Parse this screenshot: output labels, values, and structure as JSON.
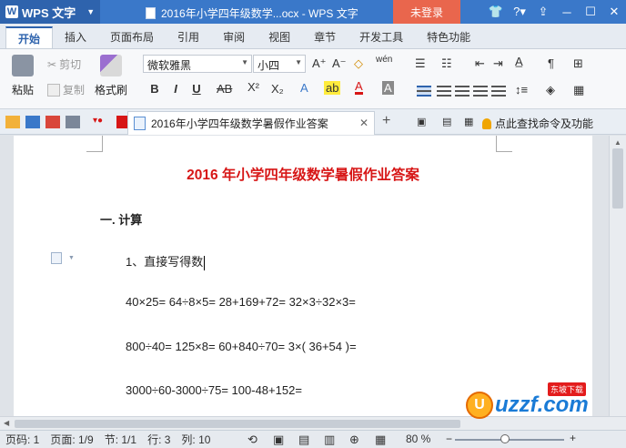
{
  "app": {
    "name": "WPS 文字",
    "window_title": "2016年小学四年级数学...ocx - WPS 文字",
    "login_label": "未登录"
  },
  "tabs": [
    {
      "label": "开始",
      "active": true
    },
    {
      "label": "插入"
    },
    {
      "label": "页面布局"
    },
    {
      "label": "引用"
    },
    {
      "label": "审阅"
    },
    {
      "label": "视图"
    },
    {
      "label": "章节"
    },
    {
      "label": "开发工具"
    },
    {
      "label": "特色功能"
    }
  ],
  "ribbon": {
    "paste_label": "粘贴",
    "cut_label": "剪切",
    "copy_label": "复制",
    "format_painter_label": "格式刷",
    "font_name": "微软雅黑",
    "font_size": "小四"
  },
  "doc_tab": {
    "label": "2016年小学四年级数学暑假作业答案",
    "find_command": "点此查找命令及功能"
  },
  "document": {
    "title": "2016 年小学四年级数学暑假作业答案",
    "heading": "一. 计算",
    "item1": "1、直接写得数",
    "line1": "40×25= 64÷8×5= 28+169+72= 32×3÷32×3=",
    "line2": "800÷40= 125×8= 60+840÷70= 3×( 36+54 )=",
    "line3": "3000÷60-3000÷75= 100-48+152="
  },
  "watermark": {
    "text": "uzzf.com",
    "tag": "东坡下载"
  },
  "status": {
    "page": "页码: 1",
    "pages": "页面: 1/9",
    "section": "节: 1/1",
    "row": "行: 3",
    "col": "列: 10",
    "zoom": "80 %"
  }
}
